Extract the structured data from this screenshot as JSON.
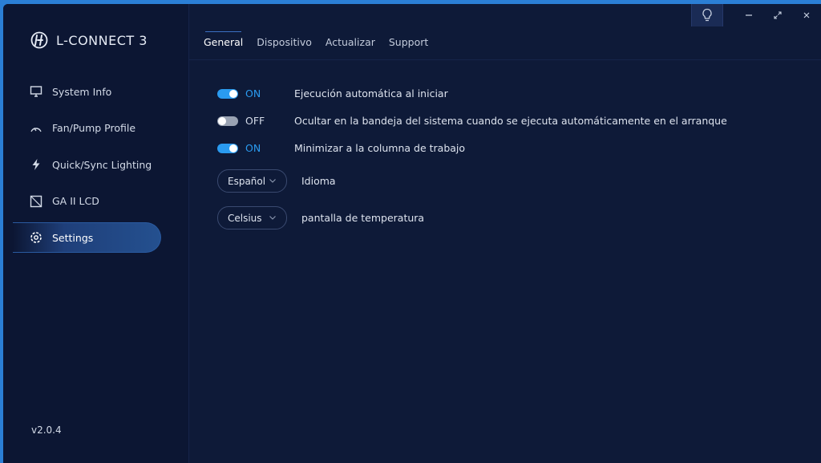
{
  "app": {
    "title": "L-CONNECT 3",
    "version": "v2.0.4"
  },
  "sidebar": {
    "items": [
      {
        "label": "System Info",
        "icon": "monitor-icon"
      },
      {
        "label": "Fan/Pump Profile",
        "icon": "gauge-icon"
      },
      {
        "label": "Quick/Sync Lighting",
        "icon": "lightning-icon"
      },
      {
        "label": "GA II LCD",
        "icon": "lcd-icon"
      },
      {
        "label": "Settings",
        "icon": "gear-icon",
        "active": true
      }
    ]
  },
  "titlebar": {
    "buttons": [
      "bulb-icon",
      "minimize-icon",
      "maximize-icon",
      "close-icon"
    ]
  },
  "tabs": [
    {
      "label": "General",
      "active": true
    },
    {
      "label": "Dispositivo"
    },
    {
      "label": "Actualizar"
    },
    {
      "label": "Support"
    }
  ],
  "settings": {
    "toggles": [
      {
        "state": "ON",
        "on": true,
        "label": "Ejecución automática al iniciar"
      },
      {
        "state": "OFF",
        "on": false,
        "label": "Ocultar en la bandeja del sistema cuando se ejecuta automáticamente en el arranque"
      },
      {
        "state": "ON",
        "on": true,
        "label": "Minimizar a la columna de trabajo"
      }
    ],
    "language": {
      "value": "Español",
      "label": "Idioma"
    },
    "temperature": {
      "value": "Celsius",
      "label": "pantalla de temperatura"
    }
  },
  "colors": {
    "accent": "#2a9bf0",
    "background": "#0e1a38",
    "sidebar": "#0c1633"
  }
}
